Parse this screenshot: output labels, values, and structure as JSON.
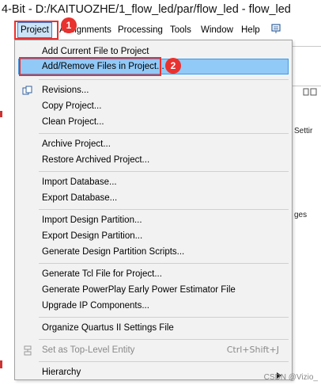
{
  "window": {
    "title": "4-Bit - D:/KAITUOZHE/1_flow_led/par/flow_led - flow_led"
  },
  "menubar": {
    "items": [
      {
        "label": "Project",
        "underline": "P"
      },
      {
        "label": "Assignments",
        "underline": "s"
      },
      {
        "label": "Processing",
        "underline": "r"
      },
      {
        "label": "Tools",
        "underline": "T"
      },
      {
        "label": "Window",
        "underline": "W"
      },
      {
        "label": "Help",
        "underline": "H"
      }
    ],
    "extra_icon": "toolbar-customize-icon"
  },
  "annotations": {
    "badge1": "1",
    "badge2": "2"
  },
  "dropdown": {
    "items": [
      "Add Current File to Project",
      "Add/Remove Files in Project...",
      "Revisions...",
      "Copy Project...",
      "Clean Project...",
      "Archive Project...",
      "Restore Archived Project...",
      "Import Database...",
      "Export Database...",
      "Import Design Partition...",
      "Export Design Partition...",
      "Generate Design Partition Scripts...",
      "Generate Tcl File for Project...",
      "Generate PowerPlay Early Power Estimator File",
      "Upgrade IP Components...",
      "Organize Quartus II Settings File",
      "Set as Top-Level Entity",
      "Hierarchy"
    ],
    "shortcut_top_level": "Ctrl+Shift+J"
  },
  "background_fragments": {
    "settings": "Settir",
    "ges": "ges",
    "watermark": "CSDN @Vizio_"
  },
  "colors": {
    "highlight_box": "#e8322f",
    "hover_fill": "#91c9f7",
    "hover_border": "#3c9be8"
  }
}
